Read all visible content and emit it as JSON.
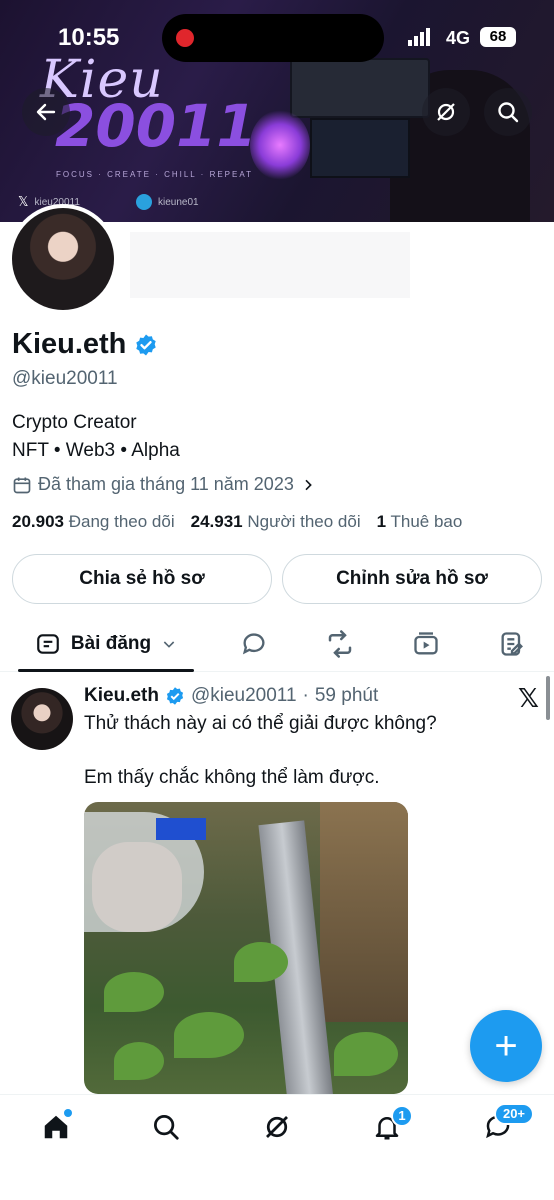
{
  "status_bar": {
    "time": "10:55",
    "network": "4G",
    "battery": "68"
  },
  "banner": {
    "brand_line1": "Kieu",
    "brand_line2": "20011",
    "motto": "FOCUS · CREATE · CHILL · REPEAT",
    "x_handle": "kieu20011",
    "telegram_handle": "kieune01"
  },
  "profile": {
    "name": "Kieu.eth",
    "handle": "@kieu20011",
    "bio_line1": "Crypto Creator",
    "bio_line2": "NFT • Web3 • Alpha",
    "joined": "Đã tham gia tháng 11 năm 2023",
    "following_count": "20.903",
    "following_label": "Đang theo dõi",
    "followers_count": "24.931",
    "followers_label": "Người theo dõi",
    "subs_count": "1",
    "subs_label": "Thuê bao"
  },
  "actions": {
    "share": "Chia sẻ hồ sơ",
    "edit": "Chỉnh sửa hồ sơ"
  },
  "tabs": {
    "active": "Bài đăng"
  },
  "post": {
    "name": "Kieu.eth",
    "handle": "@kieu20011",
    "time": "59 phút",
    "text1": "Thử thách này ai có thể giải được không?",
    "text2": "Em thấy chắc không thể làm được."
  },
  "nav": {
    "notifications_badge": "1",
    "messages_badge": "20+"
  },
  "colors": {
    "accent": "#1d9bf0",
    "text": "#0f1419",
    "muted": "#536471"
  }
}
